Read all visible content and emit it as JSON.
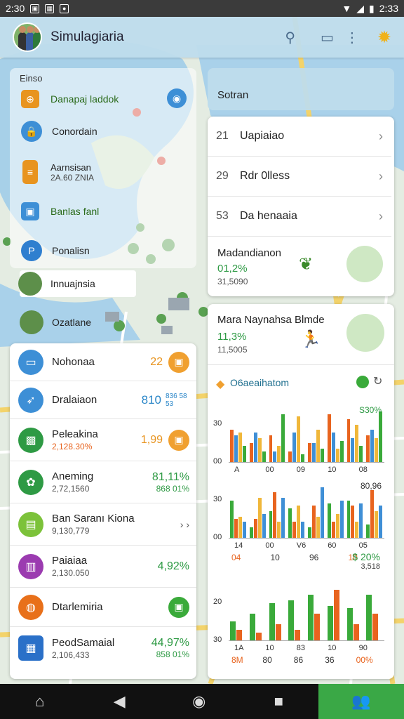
{
  "status": {
    "time": "2:30",
    "right_time": "2:33"
  },
  "app": {
    "title": "Simulagiaria"
  },
  "map_panel": {
    "heading": "Einso",
    "items": [
      {
        "label": "Danapaj laddok",
        "color": "#e8941f"
      },
      {
        "label": "Conordain",
        "color": "#3d8fd6"
      },
      {
        "label": "Aarnsisan",
        "sub": "2A.60 ZNIA",
        "color": "#e8941f"
      },
      {
        "label": "Banlas fanl",
        "color": "#3d8fd6"
      },
      {
        "label": "Ponalisn",
        "color": "#2f7fcf"
      },
      {
        "label": "Innuajnsia",
        "color": "#2a6a3a"
      },
      {
        "label": "Ozatlane",
        "color": "#2a6a3a"
      }
    ]
  },
  "search": {
    "label": "Sotran"
  },
  "right_list": [
    {
      "num": "21",
      "label": "Uapiaiao"
    },
    {
      "num": "29",
      "label": "Rdr 0lless"
    },
    {
      "num": "53",
      "label": "Da henaaia"
    }
  ],
  "promo1": {
    "title": "Madandianon",
    "value": "01,2%",
    "sub": "31,5090"
  },
  "promo2": {
    "title": "Mara Naynahsa Blmde",
    "value": "11,3%",
    "sub": "11,5005"
  },
  "left_list": [
    {
      "title": "Nohonaa",
      "sub": "",
      "value": "22",
      "value_color": "#e8941f",
      "icon_color": "#3d8fd6",
      "badge_color": "#f0a030"
    },
    {
      "title": "Dralaiaon",
      "sub": "",
      "value": "810",
      "value2": "836 58 53",
      "value_color": "#2a86c8",
      "icon_color": "#3d8fd6",
      "badge_color": ""
    },
    {
      "title": "Peleakina",
      "sub": "2,128.30%",
      "value": "1,99",
      "value_color": "#e8941f",
      "icon_color": "#2e9a44",
      "badge_color": "#f0a030"
    },
    {
      "title": "Aneming",
      "sub": "2,72,1560",
      "value": "81,11%",
      "value2": "868 01%",
      "value_color": "#2e9a44",
      "icon_color": "#2e9a44",
      "badge_color": ""
    },
    {
      "title": "Ban Saranı Kiona",
      "sub": "9,130,779",
      "value": "› ›",
      "value_color": "#555",
      "icon_color": "#7cc23a",
      "badge_color": ""
    },
    {
      "title": "Paiaiaa",
      "sub": "2,130.050",
      "value": "4,92%",
      "value_color": "#2e9a44",
      "icon_color": "#9b3bb0",
      "badge_color": ""
    },
    {
      "title": "Dtarlemiria",
      "sub": "",
      "value": "",
      "value_color": "#2e9a44",
      "icon_color": "#e8701a",
      "badge_color": "#3aaa3a"
    },
    {
      "title": "PeodSamaial",
      "sub": "2,106,433",
      "value": "44,97%",
      "value2": "858 01%",
      "value_color": "#2e9a44",
      "icon_color": "#2a70c8",
      "badge_color": ""
    }
  ],
  "chart_section": {
    "title": "O6aeaihatom"
  },
  "chart_data": [
    {
      "type": "bar",
      "title": "",
      "y_ticks": [
        "30",
        "00"
      ],
      "x_labels": [
        "A",
        "00",
        "09",
        "10",
        "08"
      ],
      "annotation": "S30%",
      "series": [
        {
          "color": "#e8641f",
          "values": [
            0.6,
            0.35,
            0.5,
            0.2,
            0.35,
            0.9,
            0.8,
            0.5
          ]
        },
        {
          "color": "#3f8fd6",
          "values": [
            0.5,
            0.55,
            0.2,
            0.55,
            0.35,
            0.55,
            0.45,
            0.6
          ]
        },
        {
          "color": "#f0b73a",
          "values": [
            0.55,
            0.45,
            0.3,
            0.85,
            0.6,
            0.25,
            0.7,
            0.45
          ]
        },
        {
          "color": "#3aaa3a",
          "values": [
            0.3,
            0.2,
            0.9,
            0.15,
            0.25,
            0.4,
            0.3,
            0.95
          ]
        }
      ]
    },
    {
      "type": "bar",
      "title": "",
      "y_ticks": [
        "30",
        "00"
      ],
      "x_labels": [
        "14",
        "00",
        "V6",
        "60",
        "05"
      ],
      "bottom_labels": [
        "04",
        "10",
        "96",
        "10"
      ],
      "annotation": "80,96",
      "value_labels": [
        "$ 20%",
        "3,518"
      ],
      "series": [
        {
          "color": "#3aaa3a",
          "values": [
            0.7,
            0.2,
            0.5,
            0.55,
            0.2,
            0.65,
            0.7,
            0.25
          ]
        },
        {
          "color": "#e8641f",
          "values": [
            0.35,
            0.35,
            0.85,
            0.3,
            0.6,
            0.3,
            0.6,
            0.9
          ]
        },
        {
          "color": "#f0b73a",
          "values": [
            0.4,
            0.75,
            0.3,
            0.6,
            0.4,
            0.45,
            0.3,
            0.5
          ]
        },
        {
          "color": "#3f8fd6",
          "values": [
            0.3,
            0.45,
            0.75,
            0.3,
            0.95,
            0.7,
            0.65,
            0.6
          ]
        }
      ]
    },
    {
      "type": "bar",
      "title": "",
      "y_ticks": [
        "20",
        "30"
      ],
      "x_labels": [
        "1A",
        "10",
        "83",
        "10",
        "90"
      ],
      "bottom_labels": [
        "8M",
        "80",
        "86",
        "36",
        "00%"
      ],
      "series": [
        {
          "color": "#3aaa3a",
          "values": [
            0.35,
            0.5,
            0.7,
            0.75,
            0.85,
            0.65,
            0.6,
            0.85
          ]
        },
        {
          "color": "#e8641f",
          "values": [
            0.2,
            0.15,
            0.3,
            0.2,
            0.5,
            0.95,
            0.3,
            0.5
          ]
        }
      ]
    }
  ],
  "nav": {
    "home": "⌂",
    "back": "◀",
    "circle": "◉",
    "square": "■",
    "people": "👥"
  }
}
